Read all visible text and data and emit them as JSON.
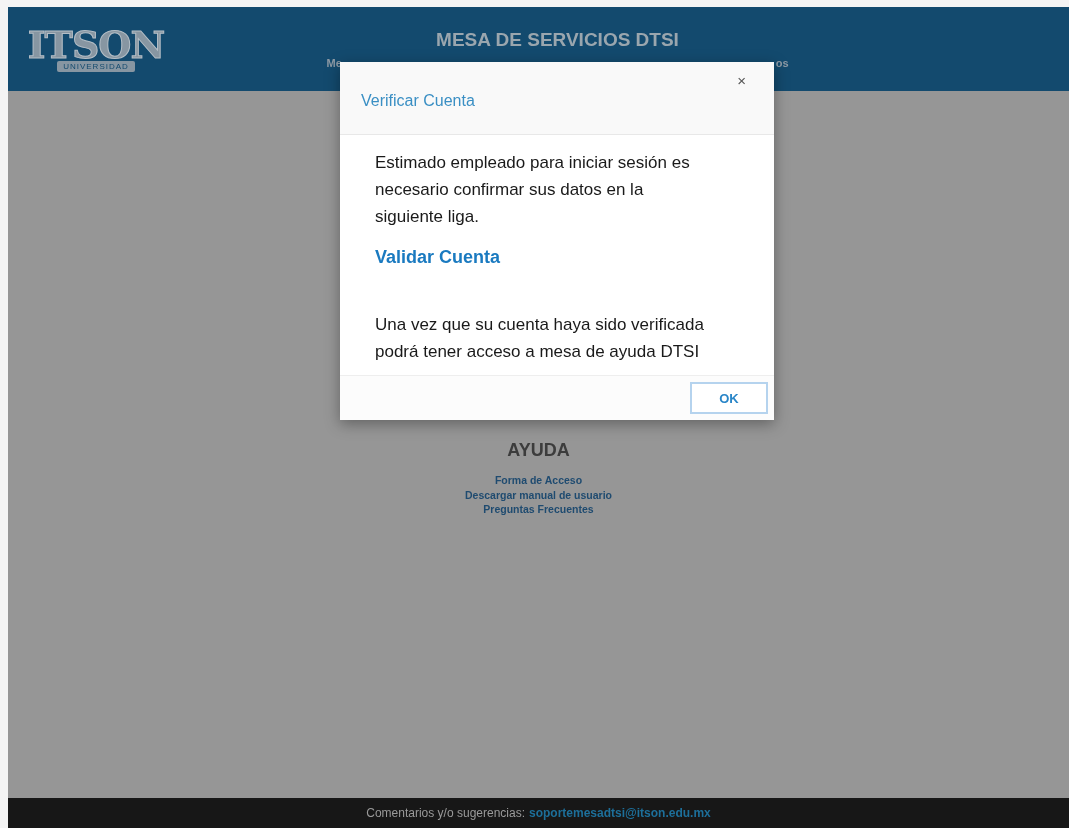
{
  "header": {
    "logo": {
      "word": "ITSON",
      "tagline": "UNIVERSIDAD"
    },
    "title": "MESA DE SERVICIOS DTSI",
    "subtitle_fragments": [
      "Me",
      "os"
    ]
  },
  "help": {
    "heading": "AYUDA",
    "links": [
      "Forma de Acceso",
      "Descargar manual de usuario",
      "Preguntas Frecuentes"
    ]
  },
  "footer": {
    "label": "Comentarios y/o sugerencias:",
    "email": "soportemesadtsi@itson.edu.mx"
  },
  "dialog": {
    "title": "Verificar Cuenta",
    "close": "×",
    "message": "Estimado empleado para iniciar sesión es necesario confirmar sus datos en la siguiente liga.",
    "link": "Validar Cuenta",
    "note": "Una vez que su cuenta haya sido verificada podrá tener acceso a mesa de ayuda DTSI",
    "button": "OK"
  }
}
